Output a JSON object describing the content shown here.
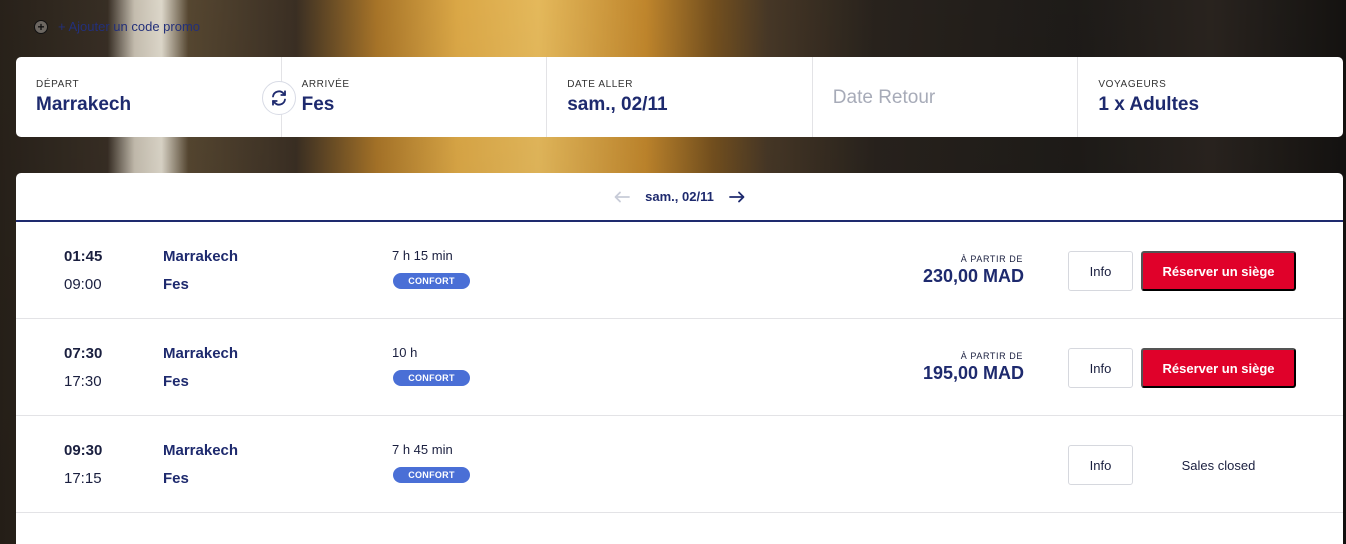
{
  "promo": {
    "icon": "plus-circle-icon",
    "label": "+ Ajouter un code promo"
  },
  "search": {
    "departure": {
      "label": "DÉPART",
      "value": "Marrakech"
    },
    "arrival": {
      "label": "ARRIVÉE",
      "value": "Fes"
    },
    "date_out": {
      "label": "DATE ALLER",
      "value": "sam., 02/11"
    },
    "date_return": {
      "placeholder": "Date Retour"
    },
    "travelers": {
      "label": "VOYAGEURS",
      "value": "1 x Adultes"
    }
  },
  "date_nav": {
    "current": "sam., 02/11"
  },
  "trips": [
    {
      "dep_time": "01:45",
      "arr_time": "09:00",
      "from": "Marrakech",
      "to": "Fes",
      "duration": "7 h 15 min",
      "class": "CONFORT",
      "price_label": "À PARTIR DE",
      "price": "230,00 MAD",
      "info": "Info",
      "action": "Réserver un siège"
    },
    {
      "dep_time": "07:30",
      "arr_time": "17:30",
      "from": "Marrakech",
      "to": "Fes",
      "duration": "10 h",
      "class": "CONFORT",
      "price_label": "À PARTIR DE",
      "price": "195,00 MAD",
      "info": "Info",
      "action": "Réserver un siège"
    },
    {
      "dep_time": "09:30",
      "arr_time": "17:15",
      "from": "Marrakech",
      "to": "Fes",
      "duration": "7 h 45 min",
      "class": "CONFORT",
      "info": "Info",
      "status": "Sales closed"
    }
  ],
  "colors": {
    "brand_navy": "#1e2a6e",
    "book_red": "#e0012a",
    "badge_blue": "#4a6fd6"
  }
}
